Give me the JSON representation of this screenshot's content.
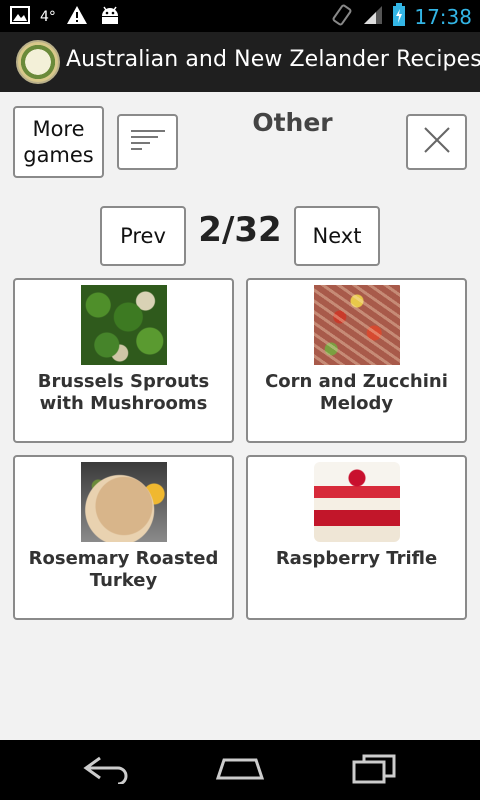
{
  "status_bar": {
    "time": "17:38",
    "temperature": "4°",
    "icons": [
      "image-icon",
      "warning-icon",
      "android-icon",
      "rotation-icon",
      "signal-icon",
      "battery-icon"
    ]
  },
  "app_bar": {
    "title": "Australian and New Zelander Recipes"
  },
  "toolbar": {
    "more_games_label": "More\ngames",
    "category_title": "Other",
    "sort_icon": "sort-lines-icon",
    "close_icon": "close-icon"
  },
  "pagination": {
    "prev_label": "Prev",
    "next_label": "Next",
    "page_indicator": "2/32"
  },
  "recipes": [
    {
      "name": "Brussels Sprouts with Mushrooms"
    },
    {
      "name": "Corn and Zucchini Melody"
    },
    {
      "name": "Rosemary Roasted Turkey"
    },
    {
      "name": "Raspberry Trifle"
    }
  ],
  "nav_bar": {
    "icons": [
      "back-icon",
      "home-icon",
      "recents-icon"
    ]
  },
  "colors": {
    "time_color": "#33b5e5",
    "action_bar": "#1f1f1f",
    "background": "#f2f2f2"
  }
}
